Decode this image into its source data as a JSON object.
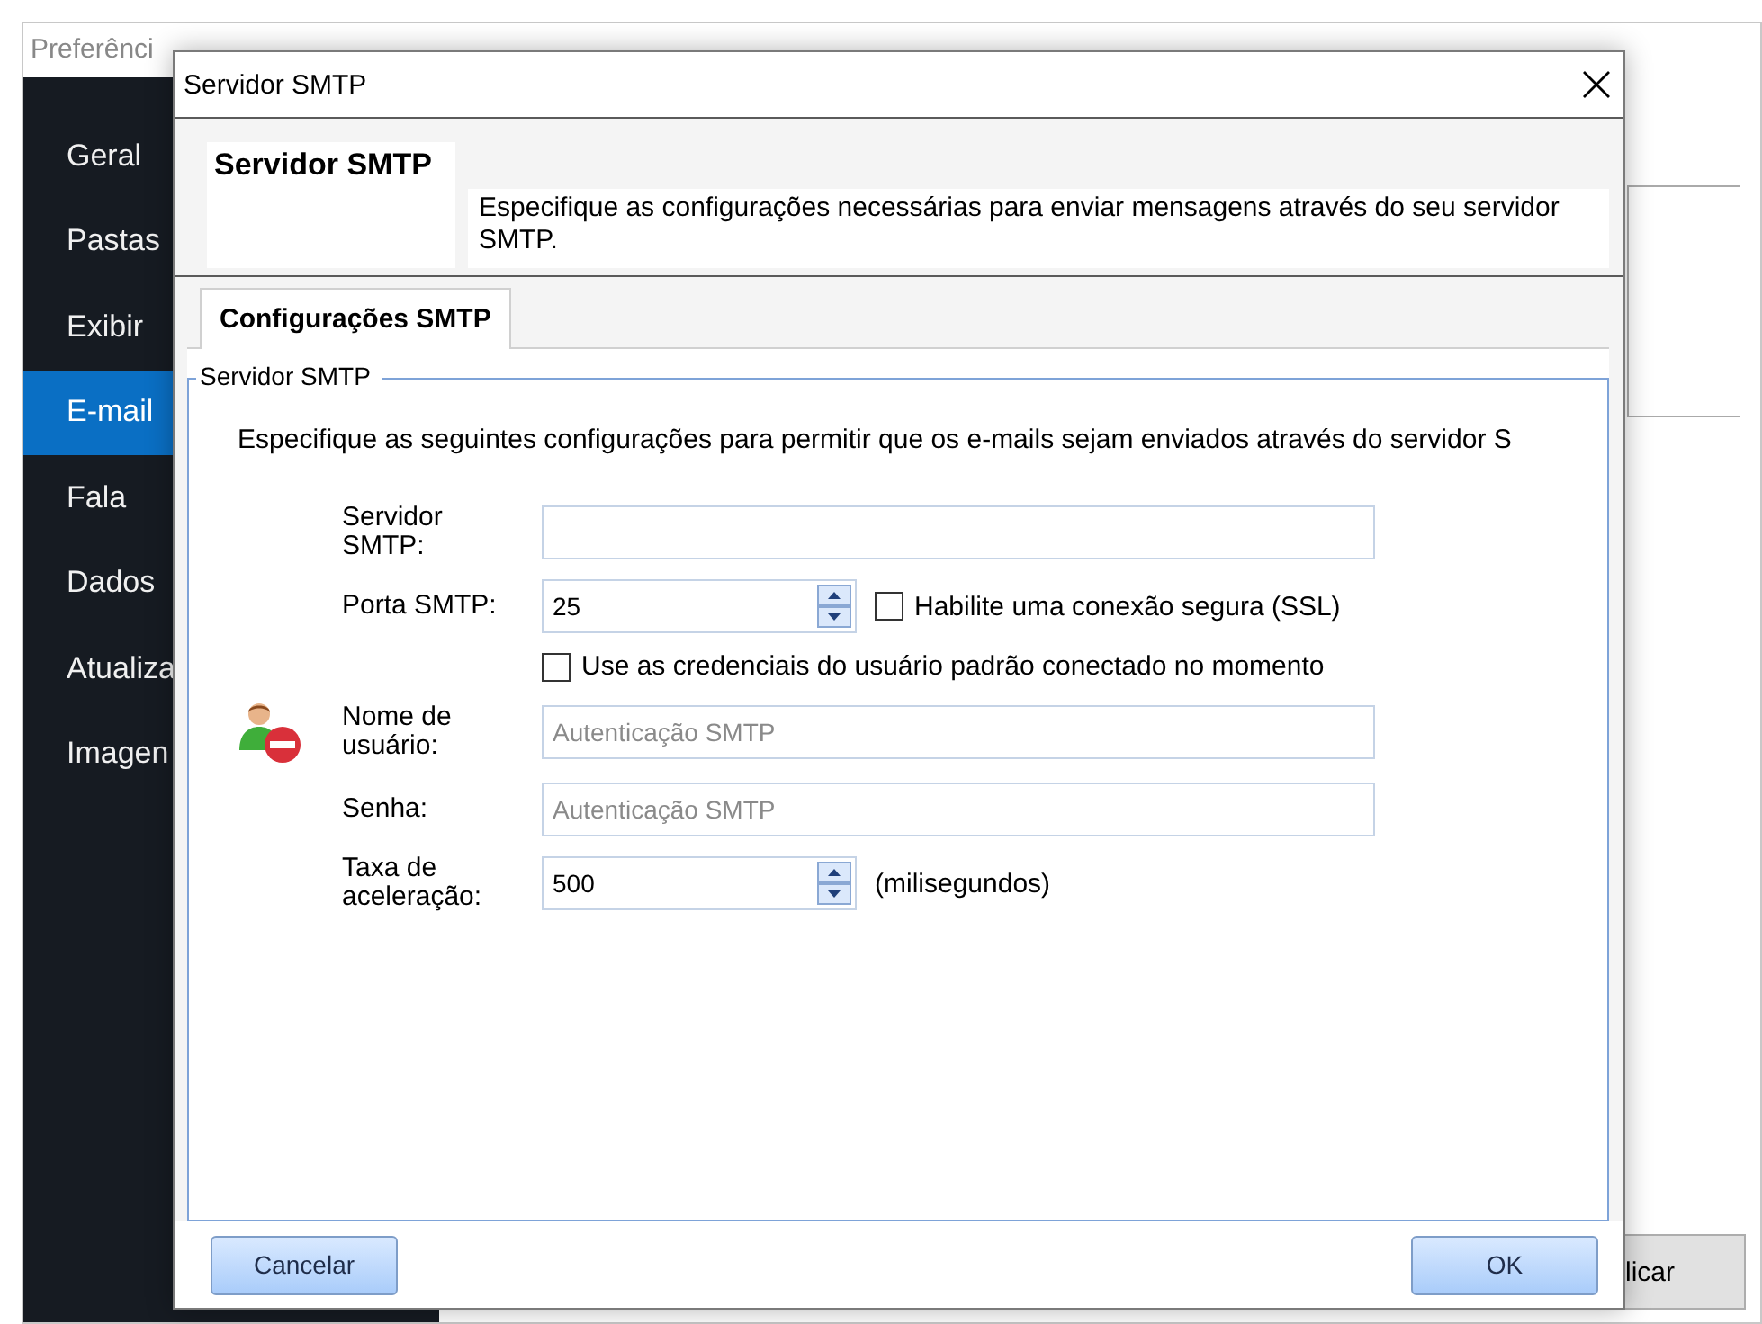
{
  "background_window": {
    "title": "Preferênci",
    "sidebar": {
      "items": [
        {
          "label": "Geral",
          "selected": false
        },
        {
          "label": "Pastas",
          "selected": false
        },
        {
          "label": "Exibir",
          "selected": false
        },
        {
          "label": "E-mail",
          "selected": true
        },
        {
          "label": "Fala",
          "selected": false
        },
        {
          "label": "Dados",
          "selected": false
        },
        {
          "label": "Atualiza",
          "selected": false
        },
        {
          "label": "Imagen",
          "selected": false
        }
      ]
    },
    "button": "licar"
  },
  "dialog": {
    "title": "Servidor SMTP",
    "header": {
      "title": "Servidor SMTP",
      "description": "Especifique as configurações necessárias para enviar mensagens através do seu servidor SMTP."
    },
    "tabs": [
      {
        "label": "Configurações SMTP",
        "selected": true
      }
    ],
    "group": {
      "legend": "Servidor SMTP",
      "intro": "Especifique as seguintes configurações para permitir que os e-mails sejam enviados através do servidor S",
      "fields": [
        {
          "kind": "text",
          "label": "Servidor SMTP:"
        },
        {
          "kind": "spinner",
          "label": "Porta SMTP:",
          "value": "25",
          "checkbox": {
            "label": "Habilite uma conexão segura (SSL)",
            "checked": false
          }
        },
        {
          "kind": "checkbox",
          "label": "Use as credenciais do usuário padrão conectado no momento",
          "checked": false
        },
        {
          "kind": "text",
          "label": "Nome de usuário:",
          "placeholder": "Autenticação SMTP"
        },
        {
          "kind": "text",
          "label": "Senha:",
          "placeholder": "Autenticação SMTP"
        },
        {
          "kind": "spinner",
          "label": "Taxa de aceleração:",
          "value": "500",
          "suffix": "(milisegundos)"
        }
      ]
    },
    "buttons": [
      {
        "label": "Cancelar"
      },
      {
        "label": "OK"
      }
    ]
  }
}
